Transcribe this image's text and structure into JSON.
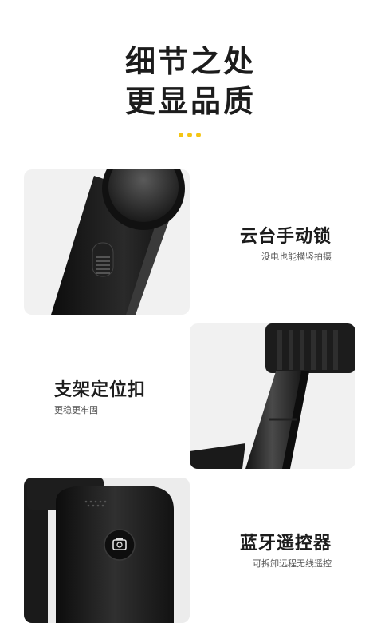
{
  "headline": {
    "line1": "细节之处",
    "line2": "更显品质"
  },
  "accent_color": "#f4c514",
  "features": [
    {
      "title": "云台手动锁",
      "subtitle": "没电也能横竖拍摄",
      "image": "gimbal-manual-lock-photo"
    },
    {
      "title": "支架定位扣",
      "subtitle": "更稳更牢固",
      "image": "tripod-positioning-buckle-photo"
    },
    {
      "title": "蓝牙遥控器",
      "subtitle": "可拆卸远程无线遥控",
      "image": "bluetooth-remote-photo"
    }
  ]
}
